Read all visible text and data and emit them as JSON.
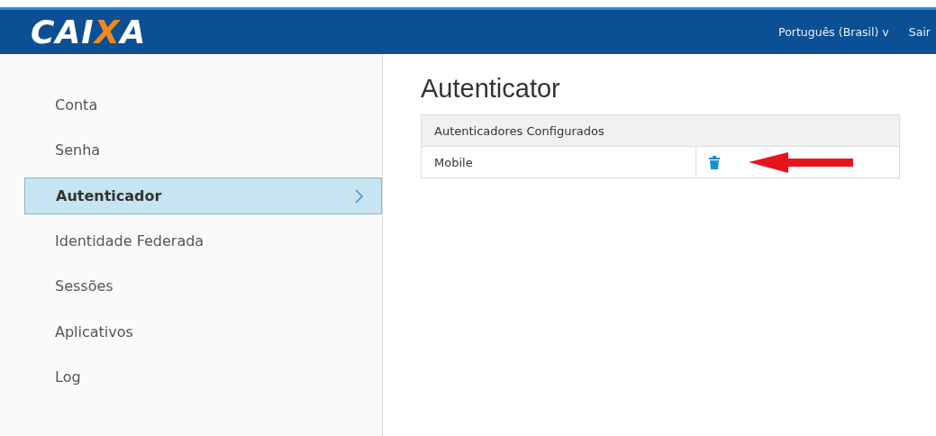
{
  "header": {
    "logo": "CAIXA",
    "language": "Português (Brasil) v",
    "logout": "Sair"
  },
  "sidebar": {
    "items": [
      {
        "label": "Conta",
        "selected": false
      },
      {
        "label": "Senha",
        "selected": false
      },
      {
        "label": "Autenticador",
        "selected": true
      },
      {
        "label": "Identidade Federada",
        "selected": false
      },
      {
        "label": "Sessões",
        "selected": false
      },
      {
        "label": "Aplicativos",
        "selected": false
      },
      {
        "label": "Log",
        "selected": false
      }
    ]
  },
  "page": {
    "title": "Autenticator",
    "table": {
      "columns": [
        "Autenticadores Configurados"
      ],
      "rows": [
        {
          "name": "Mobile"
        }
      ]
    }
  }
}
